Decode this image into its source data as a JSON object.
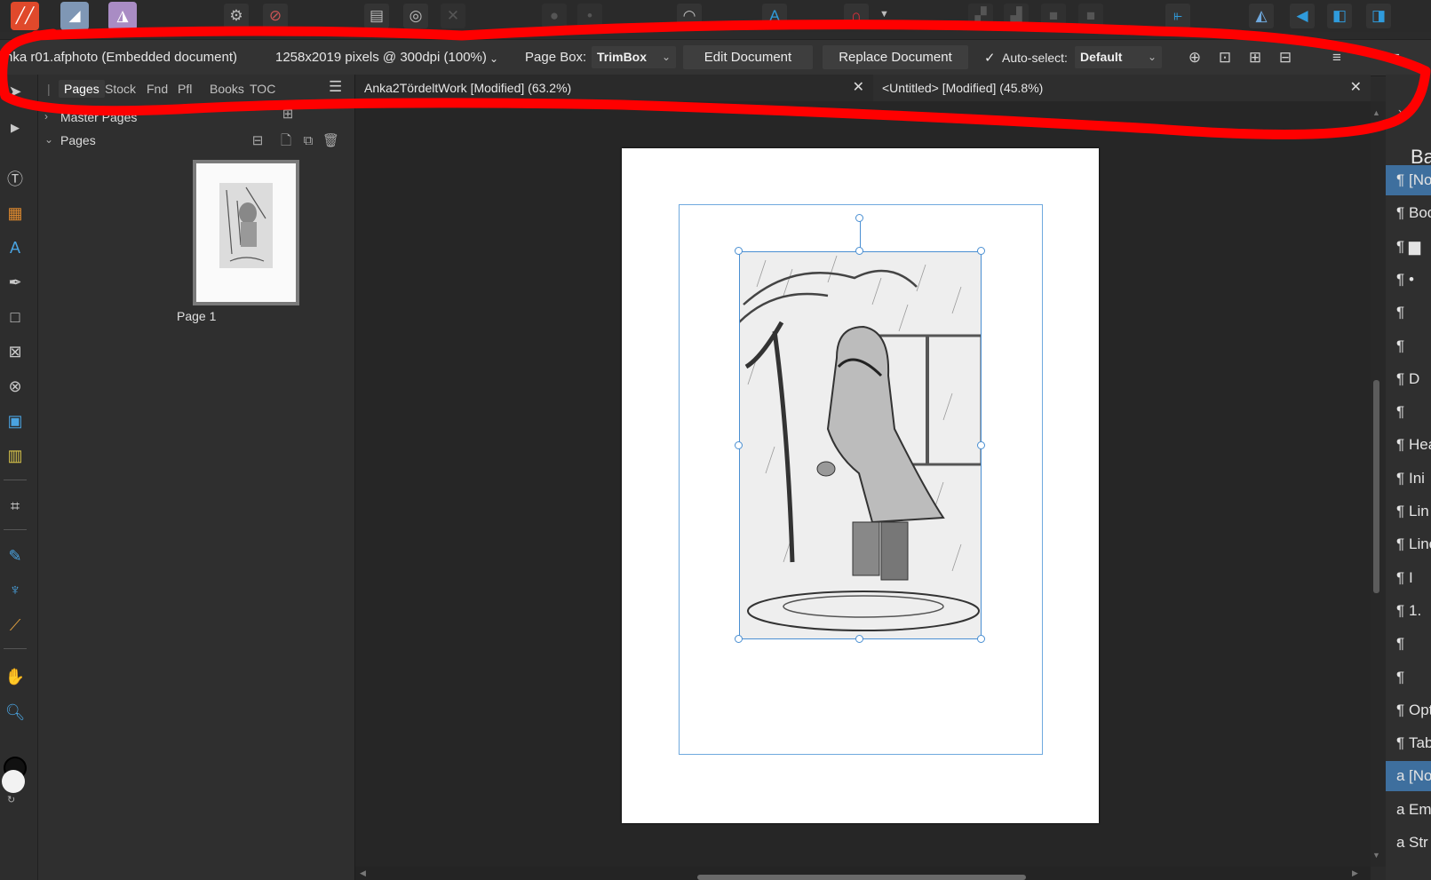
{
  "context_bar": {
    "document_name": "nka r01.afphoto (Embedded document)",
    "dimensions": "1258x2019 pixels @ 300dpi (100%)",
    "page_box_label": "Page Box:",
    "page_box_value": "TrimBox",
    "edit_document": "Edit Document",
    "replace_document": "Replace Document",
    "auto_select_label": "Auto-select:",
    "auto_select_value": "Default"
  },
  "left_panel": {
    "tabs": [
      "Pages",
      "Stock",
      "Fnd",
      "Pfl",
      "Books",
      "TOC"
    ],
    "master_pages": "Master Pages",
    "pages": "Pages",
    "page_label": "Page 1"
  },
  "document_tabs": [
    {
      "title": "Anka2TördeltWork [Modified] (63.2%)",
      "close": "✕"
    },
    {
      "title": "<Untitled> [Modified] (45.8%)",
      "close": "✕"
    }
  ],
  "right_panel": {
    "heading": "Ba",
    "styles": [
      {
        "pil": "¶",
        "text": "[No"
      },
      {
        "pil": "¶",
        "text": "Boc"
      },
      {
        "pil": "¶",
        "text": "▆"
      },
      {
        "pil": "¶",
        "text": "•"
      },
      {
        "pil": "¶",
        "text": ""
      },
      {
        "pil": "¶",
        "text": ""
      },
      {
        "pil": "¶",
        "text": "D"
      },
      {
        "pil": "¶",
        "text": ""
      },
      {
        "pil": "¶",
        "text": "Hea"
      },
      {
        "pil": "¶",
        "text": "Ini"
      },
      {
        "pil": "¶",
        "text": "Lin"
      },
      {
        "pil": "¶",
        "text": "Line"
      },
      {
        "pil": "¶",
        "text": "I"
      },
      {
        "pil": "¶",
        "text": "1."
      },
      {
        "pil": "¶",
        "text": ""
      },
      {
        "pil": "¶",
        "text": ""
      },
      {
        "pil": "¶",
        "text": "Opt"
      },
      {
        "pil": "¶",
        "text": "Tab"
      },
      {
        "pil": "a",
        "text": "[No"
      },
      {
        "pil": "a",
        "text": "Em"
      },
      {
        "pil": "a",
        "text": "Str"
      }
    ]
  },
  "colors": {
    "accent_blue": "#4a8fd2",
    "selected_row": "#3e6f9e",
    "annotation_red": "#ff0000"
  }
}
